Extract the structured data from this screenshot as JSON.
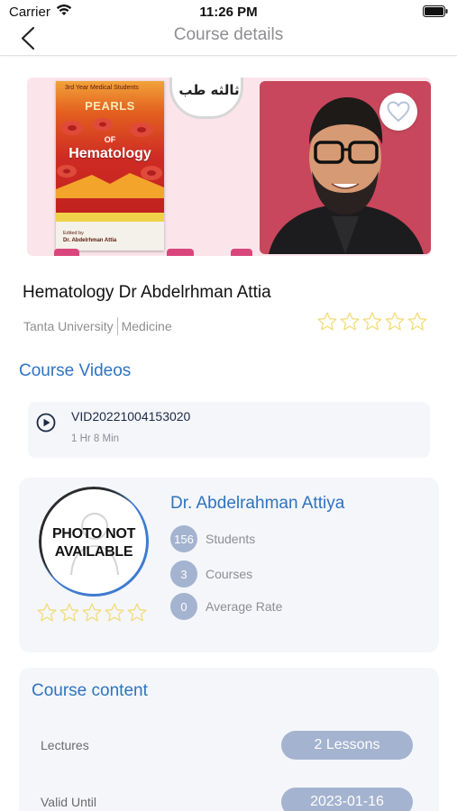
{
  "status_bar": {
    "carrier": "Carrier",
    "time": "11:26 PM"
  },
  "nav": {
    "title": "Course details",
    "back_icon": "chevron-left-icon"
  },
  "banner": {
    "book": {
      "tag": "3rd Year Medical Students",
      "pearls": "PEARLS",
      "of": "OF",
      "title": "Hematology",
      "edited_by": "Edited by",
      "author": "Dr. Abdelrhman Attia"
    },
    "arabic_badge": "ثالثه طب",
    "favorite_icon": "heart-outline-icon"
  },
  "course": {
    "title": "Hematology Dr Abdelrhman Attia",
    "university": "Tanta University",
    "faculty": "Medicine",
    "rating": 0,
    "rating_max": 5
  },
  "videos": {
    "heading": "Course Videos",
    "items": [
      {
        "name": "VID20221004153020",
        "duration": "1 Hr 8 Min",
        "icon": "play-circle-icon"
      }
    ]
  },
  "instructor": {
    "photo_line1": "PHOTO NOT",
    "photo_line2": "AVAILABLE",
    "name": "Dr. Abdelrahman Attiya",
    "rating": 0,
    "rating_max": 5,
    "stats": [
      {
        "value": "156",
        "label": "Students"
      },
      {
        "value": "3",
        "label": "Courses"
      },
      {
        "value": "0",
        "label": "Average Rate"
      }
    ]
  },
  "content": {
    "heading": "Course content",
    "rows": [
      {
        "label": "Lectures",
        "value": "2 Lessons"
      },
      {
        "label": "Valid Until",
        "value": "2023-01-16"
      }
    ]
  },
  "colors": {
    "accent": "#2f73c0",
    "pill": "#a4b3cf",
    "card_bg": "#f4f6fa",
    "star_outline": "#f2dc7a"
  }
}
